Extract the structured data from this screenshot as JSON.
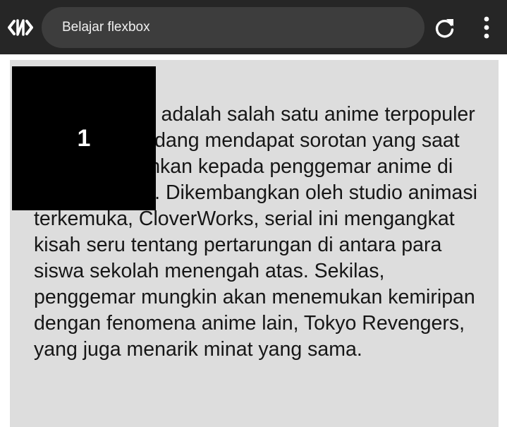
{
  "browser": {
    "logo_icon": "code-brackets-icon",
    "address_text": "Belajar flexbox",
    "reload_icon": "reload-icon",
    "menu_icon": "more-vert-icon",
    "colors": {
      "toolbar": "#262626",
      "addressbar": "#3d3d3d",
      "icon": "#ffffff"
    }
  },
  "page": {
    "box_label": "1",
    "paragraph": "Wind Breaker adalah salah satu anime terpopuler 2024 yang sedang mendapat sorotan yang saat ini dipertontonkan kepada penggemar anime di seluruh dunia. Dikembangkan oleh studio animasi terkemuka, CloverWorks, serial ini mengangkat kisah seru tentang pertarungan di antara para siswa sekolah menengah atas. Sekilas, penggemar mungkin akan menemukan kemiripan dengan fenomena anime lain, Tokyo Revengers, yang juga menarik minat yang sama.",
    "colors": {
      "container": "#dddddd",
      "box": "#000000",
      "box_text": "#ffffff",
      "text": "#161616"
    }
  }
}
